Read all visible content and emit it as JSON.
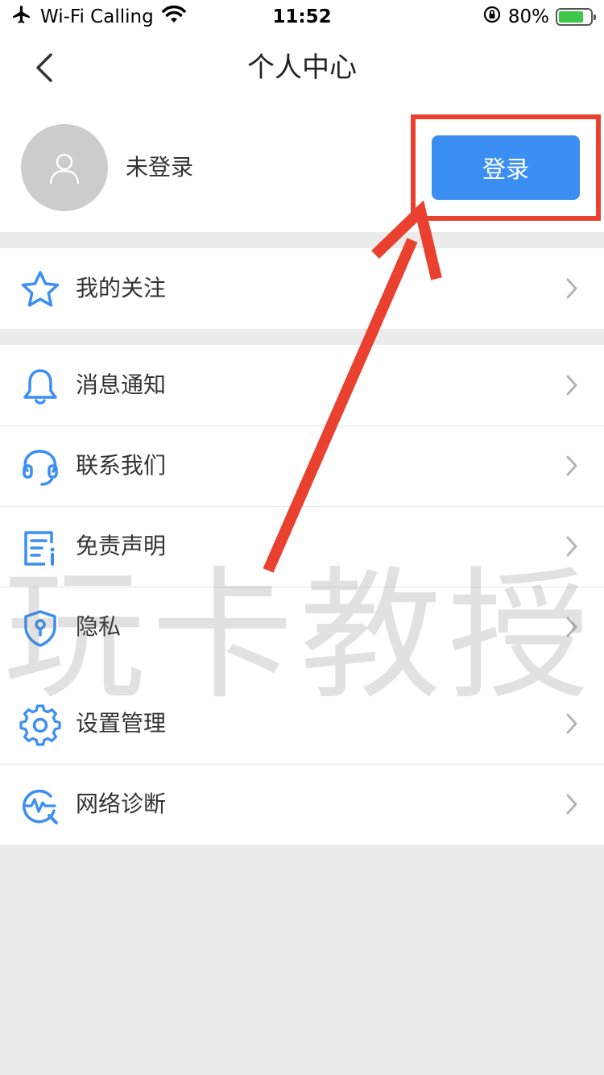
{
  "status_bar": {
    "carrier": "Wi-Fi Calling",
    "time": "11:52",
    "battery": "80%",
    "battery_level": 0.8
  },
  "nav": {
    "title": "个人中心"
  },
  "profile": {
    "name": "未登录",
    "login_label": "登录"
  },
  "menu_groups": [
    [
      {
        "label": "我的关注",
        "icon": "star-icon"
      }
    ],
    [
      {
        "label": "消息通知",
        "icon": "bell-icon"
      },
      {
        "label": "联系我们",
        "icon": "headset-icon"
      },
      {
        "label": "免责声明",
        "icon": "document-info-icon"
      },
      {
        "label": "隐私",
        "icon": "shield-icon"
      },
      {
        "label": "设置管理",
        "icon": "gear-icon"
      },
      {
        "label": "网络诊断",
        "icon": "network-diagnosis-icon"
      }
    ]
  ],
  "watermark": "玩卡教授",
  "colors": {
    "accent": "#3b8ff3",
    "annotation": "#e9402f",
    "icon": "#3b8ff3",
    "background": "#ececec"
  }
}
